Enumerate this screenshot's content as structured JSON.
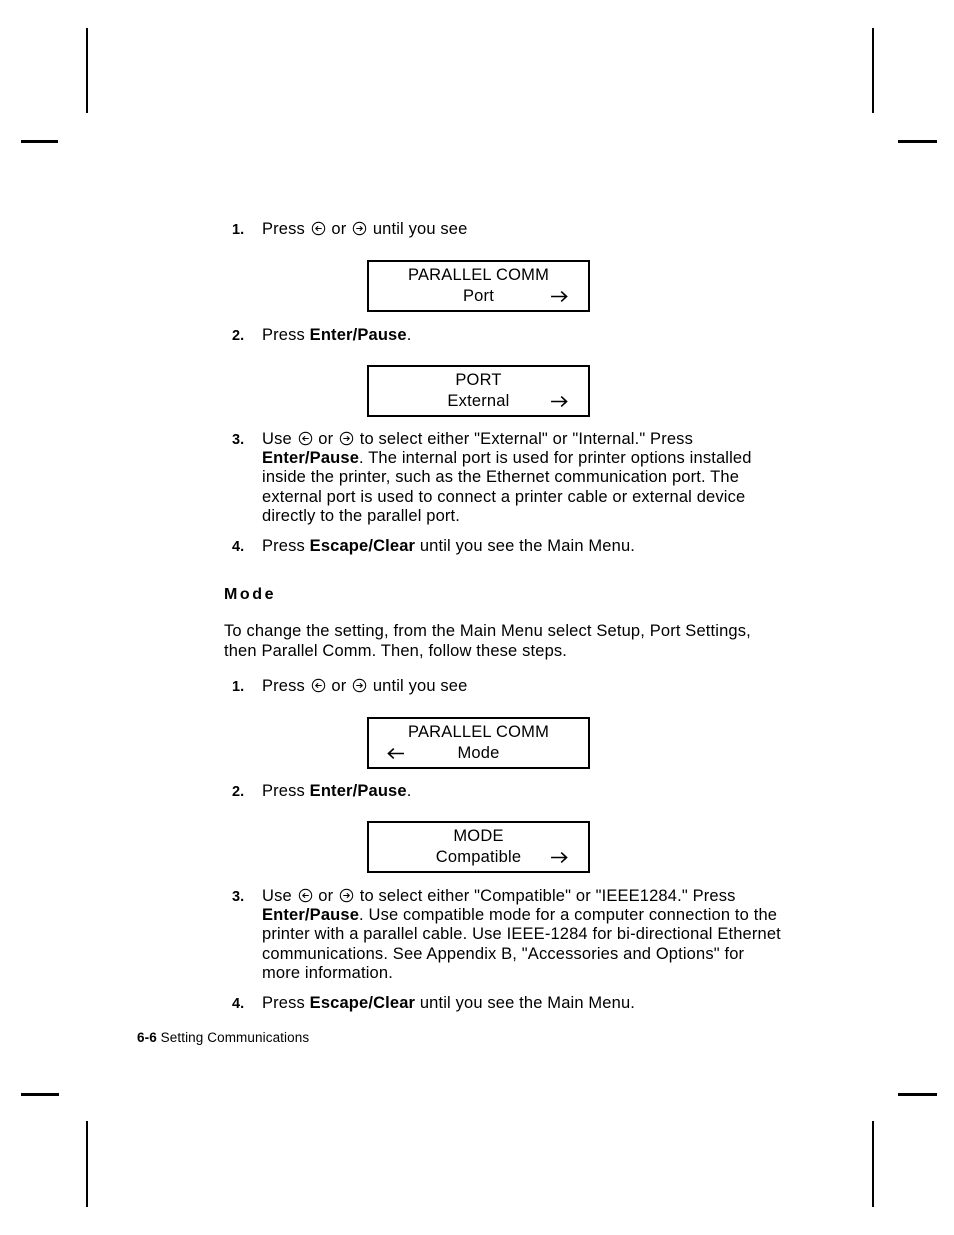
{
  "page": {
    "footer_page_number": "6-6",
    "footer_chapter": "Setting Communications"
  },
  "icons": {
    "left_key": "circled-left-arrow-icon",
    "right_key": "circled-right-arrow-icon",
    "lcd_right_arrow": "right-arrow-icon",
    "lcd_left_arrow": "left-arrow-icon"
  },
  "port_section": {
    "steps": [
      {
        "number": "1.",
        "text_before_left": "Press ",
        "text_between": " or ",
        "text_after_right": " until you see"
      },
      {
        "number": "2.",
        "prefix": "Press ",
        "bold": "Enter/Pause",
        "suffix": "."
      },
      {
        "number": "3.",
        "lead": "Use ",
        "mid": " or ",
        "after_keys": " to select either \"External\" or \"Internal.\"  Press",
        "bold": "Enter/Pause",
        "body": ".  The internal port is used for printer options installed inside the printer, such as the Ethernet communication port.  The external port is used to connect a printer cable or external device directly to the parallel port."
      },
      {
        "number": "4.",
        "prefix": "Press ",
        "bold": "Escape/Clear",
        "suffix": " until you see the Main Menu."
      }
    ],
    "display_1": {
      "line1": "PARALLEL COMM",
      "line2": "Port",
      "arrow": "right"
    },
    "display_2": {
      "line1": "PORT",
      "line2": "External",
      "arrow": "right"
    }
  },
  "mode_section": {
    "heading": "Mode",
    "intro": "To change the setting, from the Main Menu select Setup, Port Settings, then Parallel Comm.  Then, follow these steps.",
    "steps": [
      {
        "number": "1.",
        "text_before_left": "Press ",
        "text_between": " or ",
        "text_after_right": " until you see"
      },
      {
        "number": "2.",
        "prefix": "Press ",
        "bold": "Enter/Pause",
        "suffix": "."
      },
      {
        "number": "3.",
        "lead": "Use ",
        "mid": " or ",
        "after_keys": " to select either \"Compatible\" or \"IEEE1284.\"",
        "press": "Press ",
        "bold": "Enter/Pause",
        "body": ".  Use compatible mode for a computer connection to the printer with a parallel cable.  Use IEEE-1284 for bi-directional Ethernet communications.  See Appendix B, \"Accessories and Options\" for more information."
      },
      {
        "number": "4.",
        "prefix": "Press ",
        "bold": "Escape/Clear",
        "suffix": " until you see the Main Menu."
      }
    ],
    "display_1": {
      "line1": "PARALLEL COMM",
      "line2": "Mode",
      "arrow": "left"
    },
    "display_2": {
      "line1": "MODE",
      "line2": "Compatible",
      "arrow": "right"
    }
  }
}
